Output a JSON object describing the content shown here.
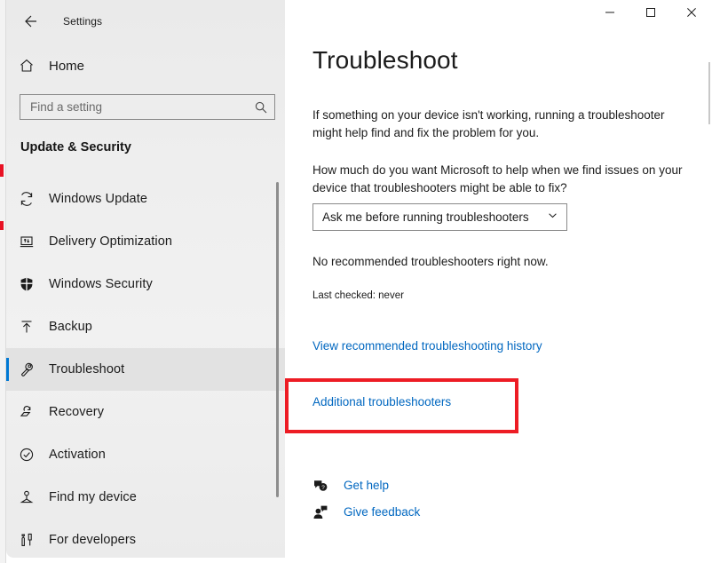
{
  "window": {
    "app_title": "Settings",
    "back_icon": "back-arrow-icon",
    "controls": {
      "minimize": "minimize-icon",
      "maximize": "maximize-icon",
      "close": "close-icon"
    }
  },
  "sidebar": {
    "home": {
      "label": "Home",
      "icon": "home-icon"
    },
    "search": {
      "placeholder": "Find a setting",
      "value": "",
      "icon": "search-icon"
    },
    "section_title": "Update & Security",
    "items": [
      {
        "label": "Windows Update",
        "icon": "refresh-icon",
        "selected": false
      },
      {
        "label": "Delivery Optimization",
        "icon": "delivery-optimization-icon",
        "selected": false
      },
      {
        "label": "Windows Security",
        "icon": "shield-icon",
        "selected": false
      },
      {
        "label": "Backup",
        "icon": "upload-arrow-icon",
        "selected": false
      },
      {
        "label": "Troubleshoot",
        "icon": "wrench-icon",
        "selected": true
      },
      {
        "label": "Recovery",
        "icon": "recovery-icon",
        "selected": false
      },
      {
        "label": "Activation",
        "icon": "check-circle-icon",
        "selected": false
      },
      {
        "label": "Find my device",
        "icon": "find-device-icon",
        "selected": false
      },
      {
        "label": "For developers",
        "icon": "developer-tools-icon",
        "selected": false
      }
    ]
  },
  "main": {
    "title": "Troubleshoot",
    "paragraph_1": "If something on your device isn't working, running a troubleshooter might help find and fix the problem for you.",
    "paragraph_2": "How much do you want Microsoft to help when we find issues on your device that troubleshooters might be able to fix?",
    "dropdown": {
      "value": "Ask me before running troubleshooters",
      "chevron_icon": "chevron-down-icon"
    },
    "status_main": "No recommended troubleshooters right now.",
    "status_sub": "Last checked: never",
    "link_history": "View recommended troubleshooting history",
    "link_additional": "Additional troubleshooters",
    "footer": [
      {
        "label": "Get help",
        "icon": "help-bubble-icon"
      },
      {
        "label": "Give feedback",
        "icon": "feedback-person-icon"
      }
    ]
  },
  "annotation": {
    "color": "#ed1c24",
    "target": "Additional troubleshooters"
  },
  "colors": {
    "accent": "#0078d4",
    "link": "#0067c0",
    "annotation_red": "#ed1c24",
    "nav_background": "#ededed",
    "selected_row": "#e2e2e2"
  }
}
